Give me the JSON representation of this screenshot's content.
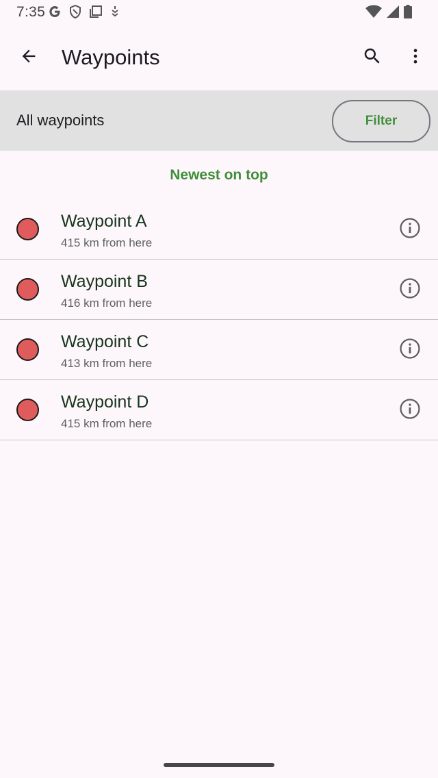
{
  "status_bar": {
    "time": "7:35",
    "left_icons": [
      "google-icon",
      "shield-icon",
      "screen-cast-icon",
      "usb-debug-icon"
    ],
    "right_icons": [
      "wifi-icon",
      "cell-signal-icon",
      "battery-icon"
    ]
  },
  "app_bar": {
    "title": "Waypoints",
    "back_icon": "arrow-back-icon",
    "search_icon": "search-icon",
    "more_icon": "more-vert-icon"
  },
  "filter_bar": {
    "label": "All waypoints",
    "filter_button": "Filter"
  },
  "sort_label": "Newest on top",
  "waypoints": [
    {
      "name": "Waypoint A",
      "distance": "415 km from here"
    },
    {
      "name": "Waypoint B",
      "distance": "416 km from here"
    },
    {
      "name": "Waypoint C",
      "distance": "413 km from here"
    },
    {
      "name": "Waypoint D",
      "distance": "415 km from here"
    }
  ],
  "colors": {
    "accent": "#3f8f3a",
    "marker": "#e05c5c",
    "background": "#fdf7fb",
    "filter_bar": "#e1e1e1"
  }
}
